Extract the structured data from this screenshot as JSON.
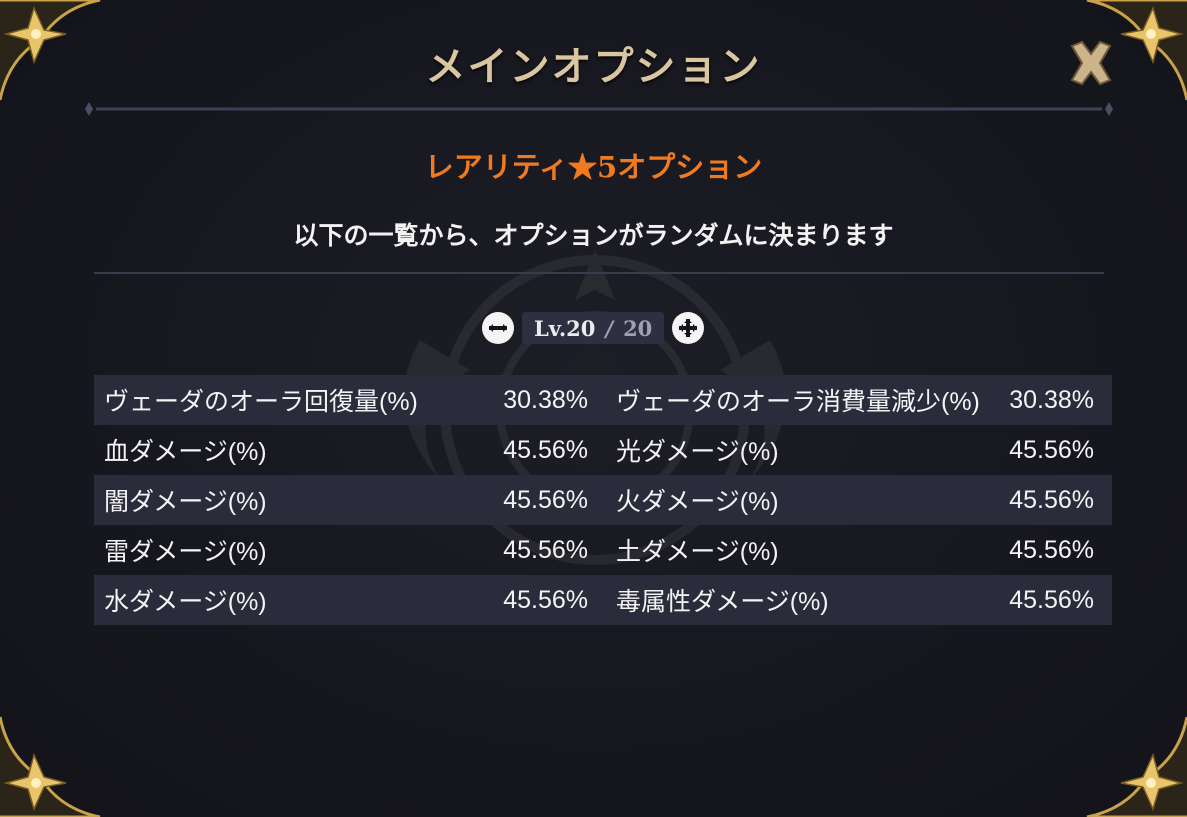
{
  "dialog": {
    "title": "メインオプション",
    "subtitle": "レアリティ★5オプション",
    "description": "以下の一覧から、オプションがランダムに決まります"
  },
  "level": {
    "current": "Lv.20",
    "separator": "/",
    "max": "20"
  },
  "icons": {
    "close": "close-icon",
    "decrease": "minus-icon",
    "increase": "plus-icon"
  },
  "colors": {
    "title": "#d9c6a0",
    "subtitle": "#f07a1d",
    "row_dark": "#2a2b3b",
    "frame_gold": "#c9a24a"
  },
  "options": [
    {
      "left_label": "ヴェーダのオーラ回復量(%)",
      "left_value": "30.38%",
      "right_label": "ヴェーダのオーラ消費量減少(%)",
      "right_value": "30.38%"
    },
    {
      "left_label": "血ダメージ(%)",
      "left_value": "45.56%",
      "right_label": "光ダメージ(%)",
      "right_value": "45.56%"
    },
    {
      "left_label": "闇ダメージ(%)",
      "left_value": "45.56%",
      "right_label": "火ダメージ(%)",
      "right_value": "45.56%"
    },
    {
      "left_label": "雷ダメージ(%)",
      "left_value": "45.56%",
      "right_label": "土ダメージ(%)",
      "right_value": "45.56%"
    },
    {
      "left_label": "水ダメージ(%)",
      "left_value": "45.56%",
      "right_label": "毒属性ダメージ(%)",
      "right_value": "45.56%"
    }
  ]
}
